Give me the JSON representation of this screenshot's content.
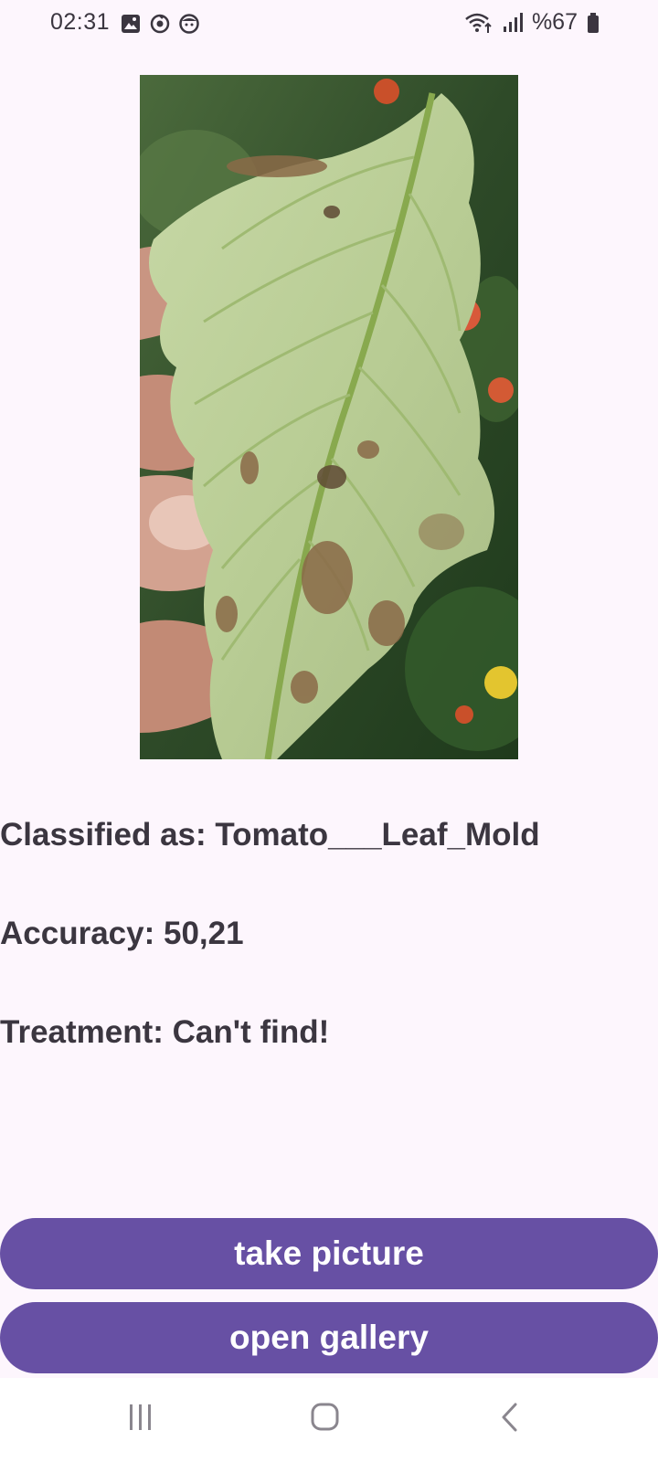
{
  "status_bar": {
    "time": "02:31",
    "left_icons": [
      "gallery-icon",
      "sync-icon",
      "face-icon"
    ],
    "right_icons": [
      "wifi-icon",
      "signal-icon",
      "battery-icon"
    ],
    "battery_text": "%67"
  },
  "photo": {
    "subject": "leaf-photo"
  },
  "result": {
    "classified": "Classified as: Tomato___Leaf_Mold",
    "accuracy": "Accuracy: 50,21",
    "treatment": "Treatment: Can't find!"
  },
  "buttons": {
    "take_picture": "take picture",
    "open_gallery": "open gallery"
  },
  "nav_bar": {
    "icons": [
      "recent-apps-icon",
      "home-icon",
      "back-icon"
    ]
  },
  "colors": {
    "background": "#fdf6fd",
    "button": "#6750a4",
    "button_text": "#ffffff",
    "text": "#3b3640"
  }
}
